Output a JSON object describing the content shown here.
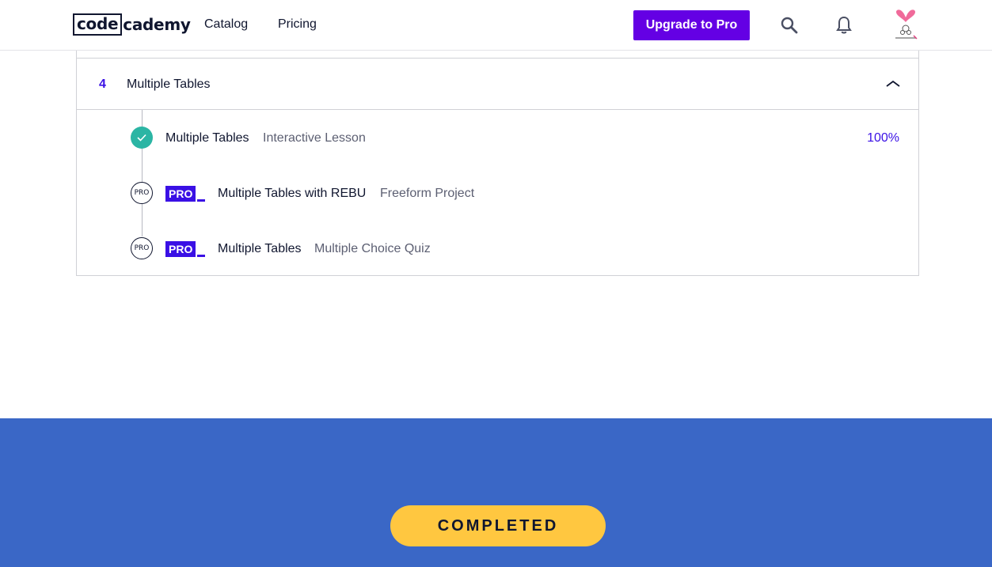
{
  "navbar": {
    "logo_boxed": "code",
    "logo_rest": "cademy",
    "links": {
      "catalog": "Catalog",
      "pricing": "Pricing"
    },
    "upgrade_label": "Upgrade to Pro",
    "search_icon": "search-icon",
    "bell_icon": "bell-icon",
    "avatar": "user-avatar"
  },
  "module": {
    "number": "4",
    "title": "Multiple Tables",
    "expanded": true,
    "items": [
      {
        "title": "Multiple Tables",
        "type": "Interactive Lesson",
        "status": "completed",
        "progress": "100%",
        "pro": false
      },
      {
        "title": "Multiple Tables with REBU",
        "type": "Freeform Project",
        "status": "locked",
        "status_label": "PRO",
        "pro": true,
        "pro_badge": "PRO"
      },
      {
        "title": "Multiple Tables",
        "type": "Multiple Choice Quiz",
        "status": "locked",
        "status_label": "PRO",
        "pro": true,
        "pro_badge": "PRO"
      }
    ]
  },
  "footer": {
    "completed_label": "COMPLETED"
  },
  "colors": {
    "brand_purple": "#6400e4",
    "accent_blue": "#3a10e5",
    "success_teal": "#2bb5a4",
    "footer_blue": "#3a67c6",
    "completed_yellow": "#ffc740"
  }
}
